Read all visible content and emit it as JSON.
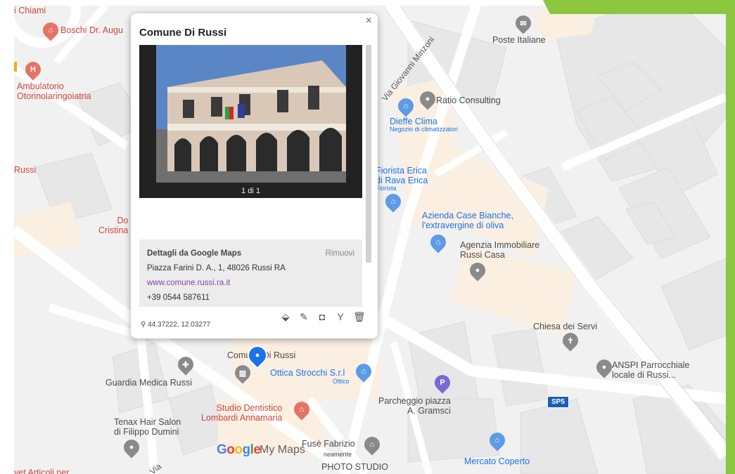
{
  "map": {
    "pois": [
      {
        "id": "chiami",
        "label": "i Chiami",
        "color": "red"
      },
      {
        "id": "boschi",
        "label": "Boschi Dr. Augu",
        "color": "red",
        "icon": "shop-icon"
      },
      {
        "id": "ambulatorio",
        "label": "Ambulatorio\nOtorinolaringoiatria",
        "color": "red",
        "icon": "hospital-icon"
      },
      {
        "id": "russi-left",
        "label": "Russi",
        "color": "red"
      },
      {
        "id": "do-cristina",
        "label": "Do\nCristina",
        "color": "red"
      },
      {
        "id": "poste",
        "label": "Poste Italiane",
        "color": "gray",
        "icon": "mail-icon"
      },
      {
        "id": "ratio",
        "label": "Ratio Consulting",
        "color": "gray",
        "icon": "pin-icon"
      },
      {
        "id": "dieffe",
        "label": "Dieffe Clima",
        "color": "blue",
        "icon": "shop-icon"
      },
      {
        "id": "dieffe-sub",
        "label": "Negozio di climatizzatori",
        "color": "blue"
      },
      {
        "id": "fiorista",
        "label": "Fiorista Erica\ndi Rava Erica",
        "color": "blue"
      },
      {
        "id": "fiorista-sub",
        "label": "Fiorista",
        "color": "blue"
      },
      {
        "id": "azienda",
        "label": "Azienda Case Bianche,\nl'extravergine di oliva",
        "color": "blue",
        "icon": "shop-icon"
      },
      {
        "id": "agenzia",
        "label": "Agenzia Immobiliare\nRussi Casa",
        "color": "gray",
        "icon": "pin-icon"
      },
      {
        "id": "chiesa",
        "label": "Chiesa dei Servi",
        "color": "gray",
        "icon": "cross-icon"
      },
      {
        "id": "anspi",
        "label": "ANSPI Parrocchiale\nlocale di Russi...",
        "color": "gray",
        "icon": "pin-icon"
      },
      {
        "id": "comune",
        "label": "Comune Di Russi",
        "color": "gray"
      },
      {
        "id": "ottica",
        "label": "Ottica Strocchi S.r.l",
        "color": "blue",
        "icon": "shop-icon"
      },
      {
        "id": "ottica-sub",
        "label": "Ottico",
        "color": "blue"
      },
      {
        "id": "guardia",
        "label": "Guardia Medica Russi",
        "color": "gray",
        "icon": "medical-icon"
      },
      {
        "id": "parcheggio",
        "label": "Parcheggio piazza\nA. Gramsci",
        "color": "gray",
        "icon": "parking-icon"
      },
      {
        "id": "studio",
        "label": "Studio Dentistico\nLombardi Annamaria",
        "color": "red",
        "icon": "shop-icon"
      },
      {
        "id": "tenax",
        "label": "Tenax Hair Salon\ndi Filippo Dumini",
        "color": "gray",
        "icon": "pin-icon"
      },
      {
        "id": "fuse",
        "label": "Fusè Fabrizio",
        "color": "gray",
        "icon": "shop-icon"
      },
      {
        "id": "fuse-sub",
        "label": "neamente",
        "color": "gray"
      },
      {
        "id": "photo",
        "label": "PHOTO STUDIO",
        "color": "gray"
      },
      {
        "id": "mercato",
        "label": "Mercato Coperto",
        "color": "blue",
        "icon": "cart-icon"
      },
      {
        "id": "articoli",
        "label": "vet Articoli per",
        "color": "red"
      }
    ],
    "roads": [
      {
        "id": "minzoni",
        "label": "Via Giovanni Minzoni"
      },
      {
        "id": "bottom-road",
        "label": "Via"
      }
    ],
    "route_shield": "SP5",
    "branding": {
      "google": [
        "G",
        "o",
        "o",
        "g",
        "l",
        "e"
      ],
      "product": "My Maps"
    }
  },
  "popup": {
    "title": "Comune Di Russi",
    "close_label": "×",
    "photo_counter": "1 di 1",
    "details": {
      "heading": "Dettagli da Google Maps",
      "remove_label": "Rimuovi",
      "address": "Piazza Farini D. A., 1, 48026 Russi RA",
      "website": "www.comune.russi.ra.it",
      "phone": "+39 0544 587611"
    },
    "coordinates": "44.37222, 12.03277",
    "tools": [
      {
        "name": "style-icon",
        "glyph": "⬙"
      },
      {
        "name": "edit-icon",
        "glyph": "✎"
      },
      {
        "name": "camera-icon",
        "glyph": "◘"
      },
      {
        "name": "directions-icon",
        "glyph": "Y"
      },
      {
        "name": "delete-icon",
        "glyph": "🗑"
      }
    ]
  },
  "colors": {
    "selected_pin": "#1a73e8",
    "accent_green": "#8cc63f",
    "poi_red": "#d0463b",
    "poi_blue": "#1a73e8",
    "poi_gray": "#6b6b6b",
    "poi_purple": "#6a5acd"
  }
}
